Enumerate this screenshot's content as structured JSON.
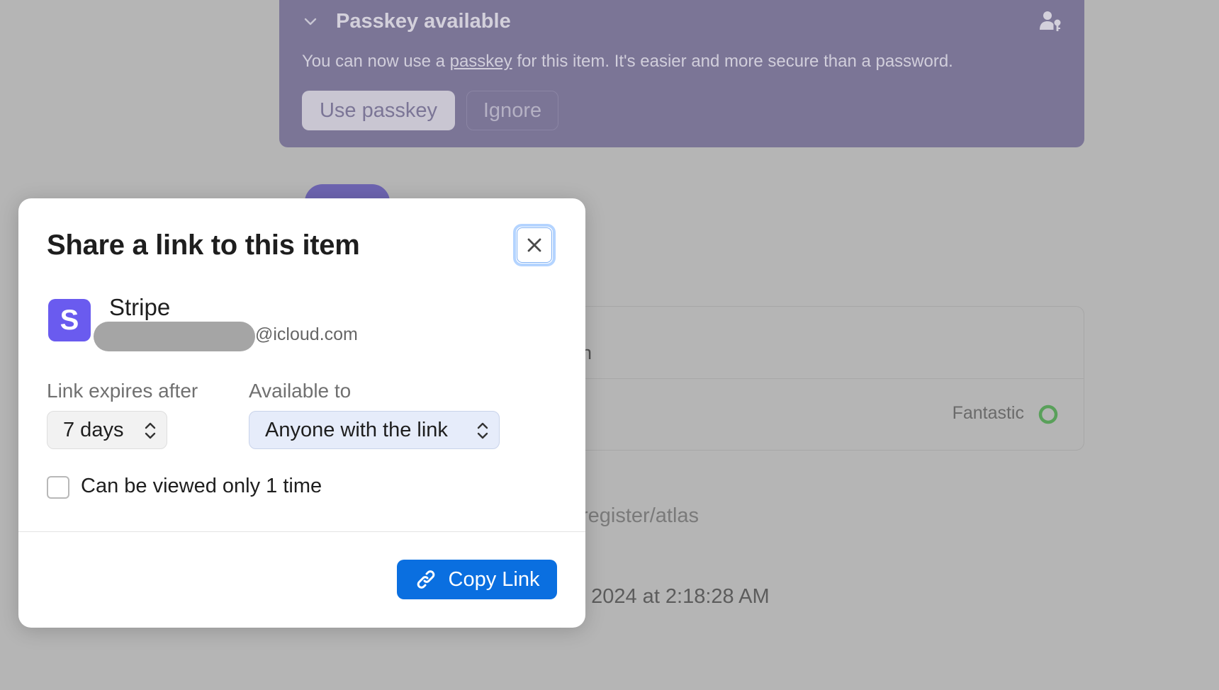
{
  "banner": {
    "title": "Passkey available",
    "text_before": "You can now use a ",
    "text_link": "passkey",
    "text_after": " for this item. It's easier and more secure than a password.",
    "use_passkey_label": "Use passkey",
    "ignore_label": "Ignore",
    "icons": {
      "collapse": "chevron-down-icon",
      "user": "user-key-icon"
    }
  },
  "background": {
    "row1_fragment": "n",
    "password_strength": "Fantastic",
    "website_fragment": "register/atlas",
    "date_fragment": ", 2024 at 2:18:28 AM"
  },
  "modal": {
    "title": "Share a link to this item",
    "close_icon": "close-icon",
    "item": {
      "icon_letter": "S",
      "name": "Stripe",
      "email_suffix": "@icloud.com"
    },
    "expires": {
      "label": "Link expires after",
      "value": "7 days"
    },
    "available": {
      "label": "Available to",
      "value": "Anyone with the link"
    },
    "view_once": {
      "label": "Can be viewed only 1 time",
      "checked": false
    },
    "copy_button": {
      "label": "Copy Link",
      "icon": "link-icon"
    }
  },
  "colors": {
    "accent": "#0a6fe0",
    "item_icon": "#6a5bef",
    "banner": "#7b7596",
    "strength_ring": "#59a05a"
  }
}
